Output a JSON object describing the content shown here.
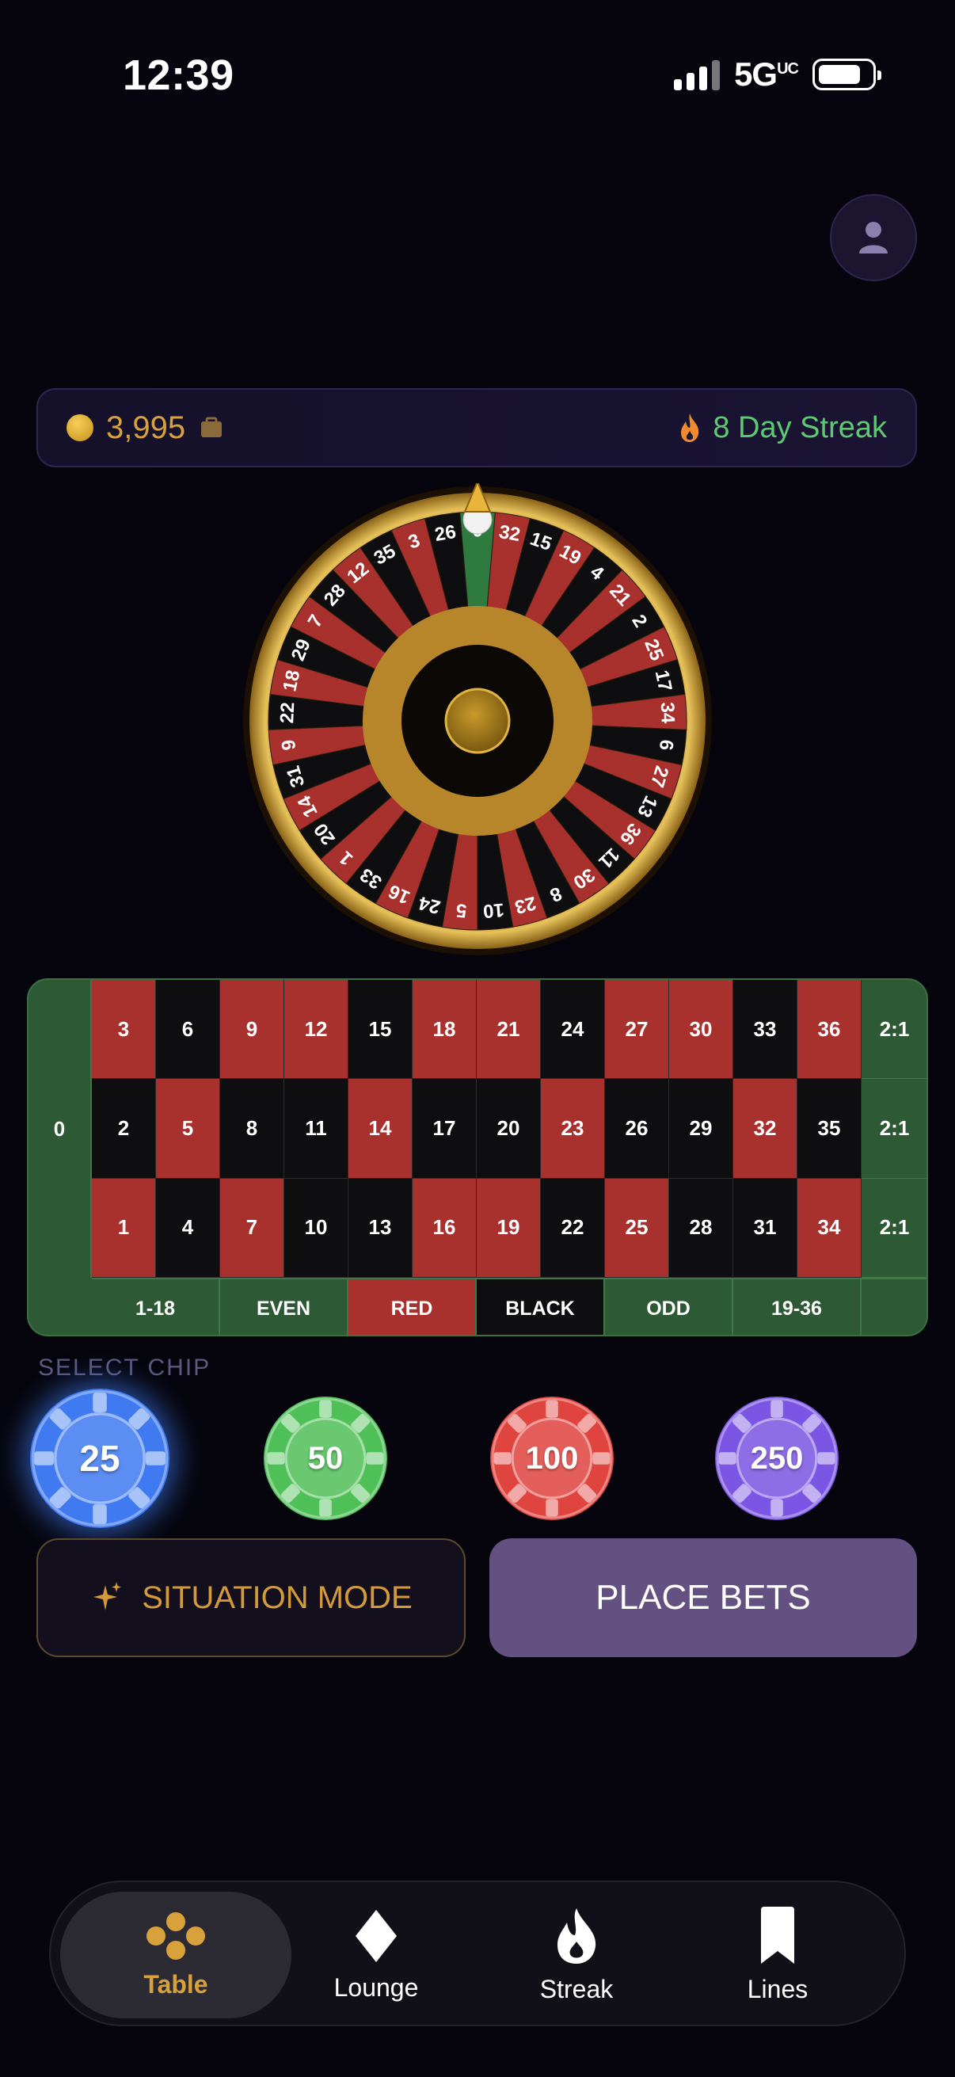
{
  "status_bar": {
    "time": "12:39",
    "network": "5G",
    "network_sup": "UC"
  },
  "balance": {
    "value": "3,995",
    "streak_label": "8 Day Streak"
  },
  "wheel": {
    "sequence": [
      "0",
      "32",
      "15",
      "19",
      "4",
      "21",
      "2",
      "25",
      "17",
      "34",
      "6",
      "27",
      "13",
      "36",
      "11",
      "30",
      "8",
      "23",
      "10",
      "5",
      "24",
      "16",
      "33",
      "1",
      "20",
      "14",
      "31",
      "9",
      "22",
      "18",
      "29",
      "7",
      "28",
      "12",
      "35",
      "3",
      "26"
    ],
    "reds": [
      "1",
      "3",
      "5",
      "7",
      "9",
      "12",
      "14",
      "16",
      "18",
      "19",
      "21",
      "23",
      "25",
      "27",
      "30",
      "32",
      "34",
      "36"
    ]
  },
  "table": {
    "zero": "0",
    "rows": [
      [
        "3",
        "6",
        "9",
        "12",
        "15",
        "18",
        "21",
        "24",
        "27",
        "30",
        "33",
        "36",
        "2:1"
      ],
      [
        "2",
        "5",
        "8",
        "11",
        "14",
        "17",
        "20",
        "23",
        "26",
        "29",
        "32",
        "35",
        "2:1"
      ],
      [
        "1",
        "4",
        "7",
        "10",
        "13",
        "16",
        "19",
        "22",
        "25",
        "28",
        "31",
        "34",
        "2:1"
      ]
    ],
    "outside": [
      "1-18",
      "EVEN",
      "RED",
      "BLACK",
      "ODD",
      "19-36"
    ]
  },
  "chips": {
    "label": "SELECT CHIP",
    "items": [
      {
        "value": "25",
        "color": "#3f7af0",
        "selected": true
      },
      {
        "value": "50",
        "color": "#4fbf58",
        "selected": false
      },
      {
        "value": "100",
        "color": "#e0443f",
        "selected": false
      },
      {
        "value": "250",
        "color": "#7b55e3",
        "selected": false
      }
    ]
  },
  "actions": {
    "situation_label": "SITUATION MODE",
    "place_label": "PLACE BETS"
  },
  "tabs": [
    {
      "label": "Table",
      "icon": "clover-icon",
      "active": true
    },
    {
      "label": "Lounge",
      "icon": "diamond-icon",
      "active": false
    },
    {
      "label": "Streak",
      "icon": "flame-icon",
      "active": false
    },
    {
      "label": "Lines",
      "icon": "bookmark-icon",
      "active": false
    }
  ],
  "colors": {
    "gold": "#d9a13c",
    "red": "#a8302d",
    "black": "#0e0e10",
    "felt": "#2d5a34",
    "streak_green": "#5ec872"
  }
}
